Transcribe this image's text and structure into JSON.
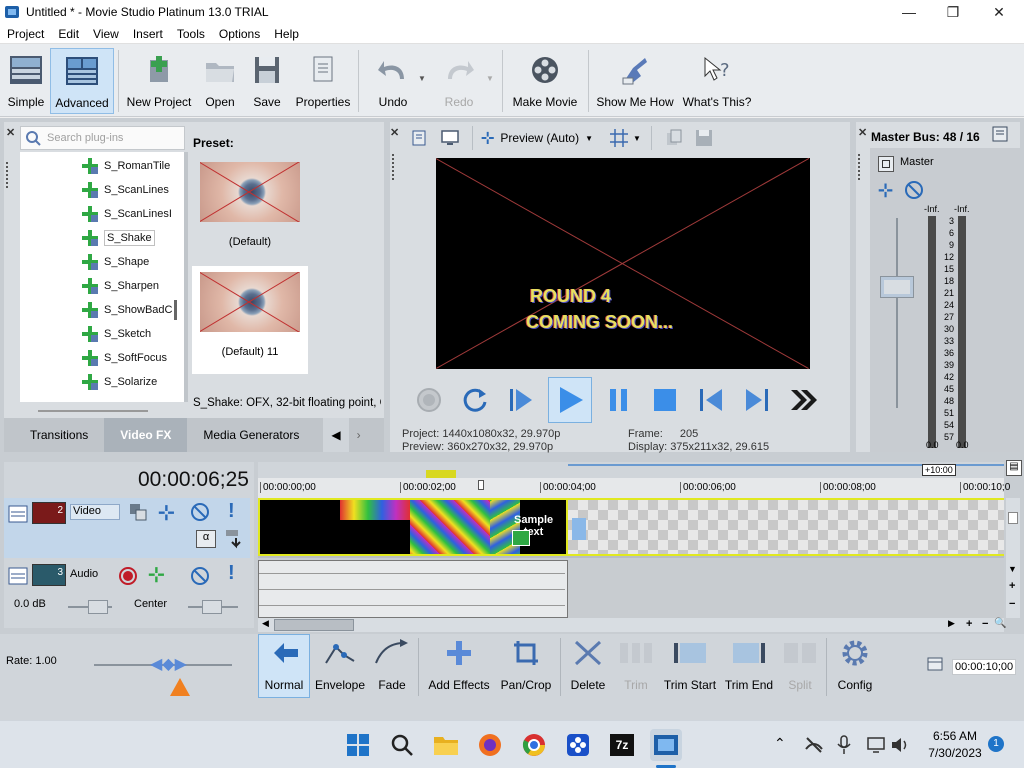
{
  "window": {
    "title": "Untitled * - Movie Studio Platinum 13.0 TRIAL",
    "minimize": "—",
    "maximize": "❐",
    "close": "✕"
  },
  "menu": [
    "Project",
    "Edit",
    "View",
    "Insert",
    "Tools",
    "Options",
    "Help"
  ],
  "toolbar": {
    "simple": "Simple",
    "advanced": "Advanced",
    "new_project": "New Project",
    "open": "Open",
    "save": "Save",
    "properties": "Properties",
    "undo": "Undo",
    "redo": "Redo",
    "make_movie": "Make Movie",
    "show_me_how": "Show Me How",
    "whats_this": "What's This?"
  },
  "browser": {
    "search_placeholder": "Search plug-ins",
    "plugins": [
      "S_RomanTile",
      "S_ScanLines",
      "S_ScanLinesI",
      "S_Shake",
      "S_Shape",
      "S_Sharpen",
      "S_ShowBadC",
      "S_Sketch",
      "S_SoftFocus",
      "S_Solarize"
    ],
    "selected_plugin": "S_Shake",
    "preset_label": "Preset:",
    "presets": [
      "(Default)",
      "(Default) 11"
    ],
    "description": "S_Shake: OFX, 32-bit floating point, G",
    "tabs": [
      "Transitions",
      "Video FX",
      "Media Generators"
    ],
    "active_tab": "Video FX"
  },
  "preview": {
    "mode": "Preview (Auto)",
    "overlay_line1": "ROUND 4",
    "overlay_line2": "COMING SOON...",
    "project_label": "Project:",
    "project_value": "1440x1080x32, 29.970p",
    "preview_label": "Preview:",
    "preview_value": "360x270x32, 29.970p",
    "frame_label": "Frame:",
    "frame_value": "205",
    "display_label": "Display:",
    "display_value": "375x211x32, 29.615"
  },
  "master": {
    "title": "Master Bus: 48 / 16",
    "label": "Master",
    "peak_left": "-Inf.",
    "peak_right": "-Inf.",
    "scale": [
      "3",
      "6",
      "9",
      "12",
      "15",
      "18",
      "21",
      "24",
      "27",
      "30",
      "33",
      "36",
      "39",
      "42",
      "45",
      "48",
      "51",
      "54",
      "57"
    ],
    "bottom_left": "0.0",
    "bottom_right": "0.0"
  },
  "timeline": {
    "timecode": "00:00:06;25",
    "ruler": [
      "00:00:00;00",
      "00:00:02;00",
      "00:00:04;00",
      "00:00:06;00",
      "00:00:08;00",
      "00:00:10;0"
    ],
    "time_badge": "+10:00",
    "video_track_num": "2",
    "video_track_name": "Video",
    "audio_track_num": "3",
    "audio_track_name": "Audio",
    "audio_volume": "0.0 dB",
    "audio_pan": "Center",
    "sample_text": "Sample\ntext",
    "rate": "Rate: 1.00",
    "end_time": "00:00:10;00"
  },
  "editbar": {
    "normal": "Normal",
    "envelope": "Envelope",
    "fade": "Fade",
    "add_effects": "Add Effects",
    "pan_crop": "Pan/Crop",
    "delete": "Delete",
    "trim": "Trim",
    "trim_start": "Trim Start",
    "trim_end": "Trim End",
    "split": "Split",
    "config": "Config"
  },
  "taskbar": {
    "time": "6:56 AM",
    "date": "7/30/2023",
    "notification_count": "1"
  },
  "colors": {
    "accent": "#1f74c8",
    "play_blue": "#3b8ee8",
    "plugin_green": "#2fa844",
    "track_yellow": "#d8e830"
  }
}
